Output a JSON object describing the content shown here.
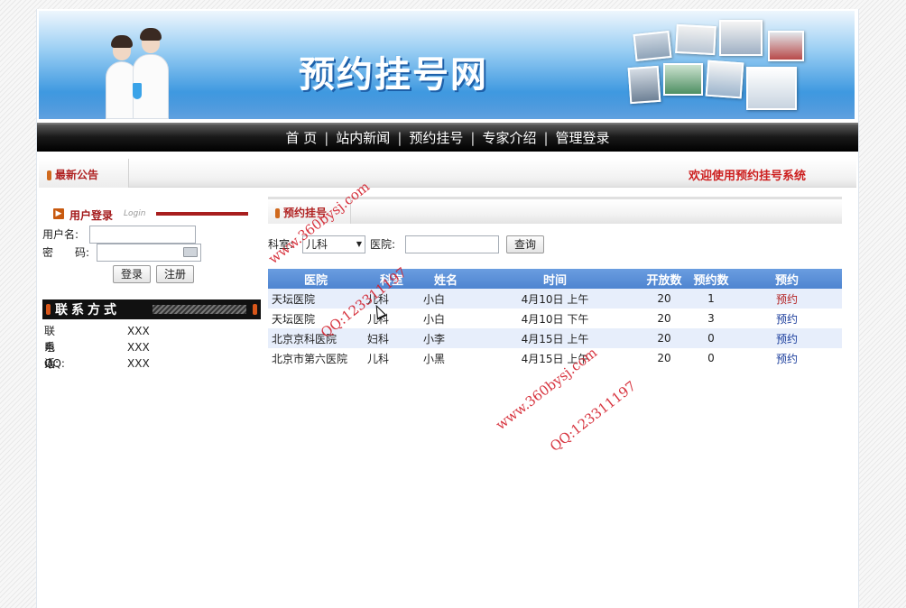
{
  "banner": {
    "site_title": "预约挂号网"
  },
  "nav": {
    "items": [
      "首 页",
      "站内新闻",
      "预约挂号",
      "专家介绍",
      "管理登录"
    ],
    "separator": "|"
  },
  "notice": {
    "label": "最新公告",
    "welcome": "欢迎使用预约挂号系统"
  },
  "login": {
    "title": "用户登录",
    "subtitle": "Login",
    "username_label": "用户名:",
    "password_label": "密　　码:",
    "username_value": "",
    "password_value": "",
    "login_button": "登录",
    "register_button": "注册"
  },
  "contact": {
    "title": "联系方式",
    "rows": [
      {
        "label": "联系人:",
        "value": "XXX"
      },
      {
        "label": "电话:",
        "value": "XXX"
      },
      {
        "label": "QQ:",
        "value": "XXX"
      }
    ]
  },
  "main": {
    "title": "预约挂号",
    "search": {
      "dept_label": "科室:",
      "dept_selected": "儿科",
      "hospital_label": "医院:",
      "hospital_value": "",
      "query_button": "查询"
    },
    "table": {
      "headers": [
        "医院",
        "科室",
        "姓名",
        "时间",
        "开放数",
        "预约数",
        "预约"
      ],
      "rows": [
        [
          "天坛医院",
          "儿科",
          "小白",
          "4月10日 上午",
          "20",
          "1",
          "预约"
        ],
        [
          "天坛医院",
          "儿科",
          "小白",
          "4月10日 下午",
          "20",
          "3",
          "预约"
        ],
        [
          "北京京科医院",
          "妇科",
          "小李",
          "4月15日 上午",
          "20",
          "0",
          "预约"
        ],
        [
          "北京市第六医院",
          "儿科",
          "小黑",
          "4月15日 上午",
          "20",
          "0",
          "预约"
        ]
      ]
    }
  },
  "watermarks": [
    "www.360bysj.com",
    "QQ:123311197",
    "www.360bysj.com",
    "QQ:123311197"
  ],
  "colors": {
    "accent_red": "#b02222",
    "table_header": "#5a8fd8",
    "banner_blue": "#2f86d8"
  }
}
